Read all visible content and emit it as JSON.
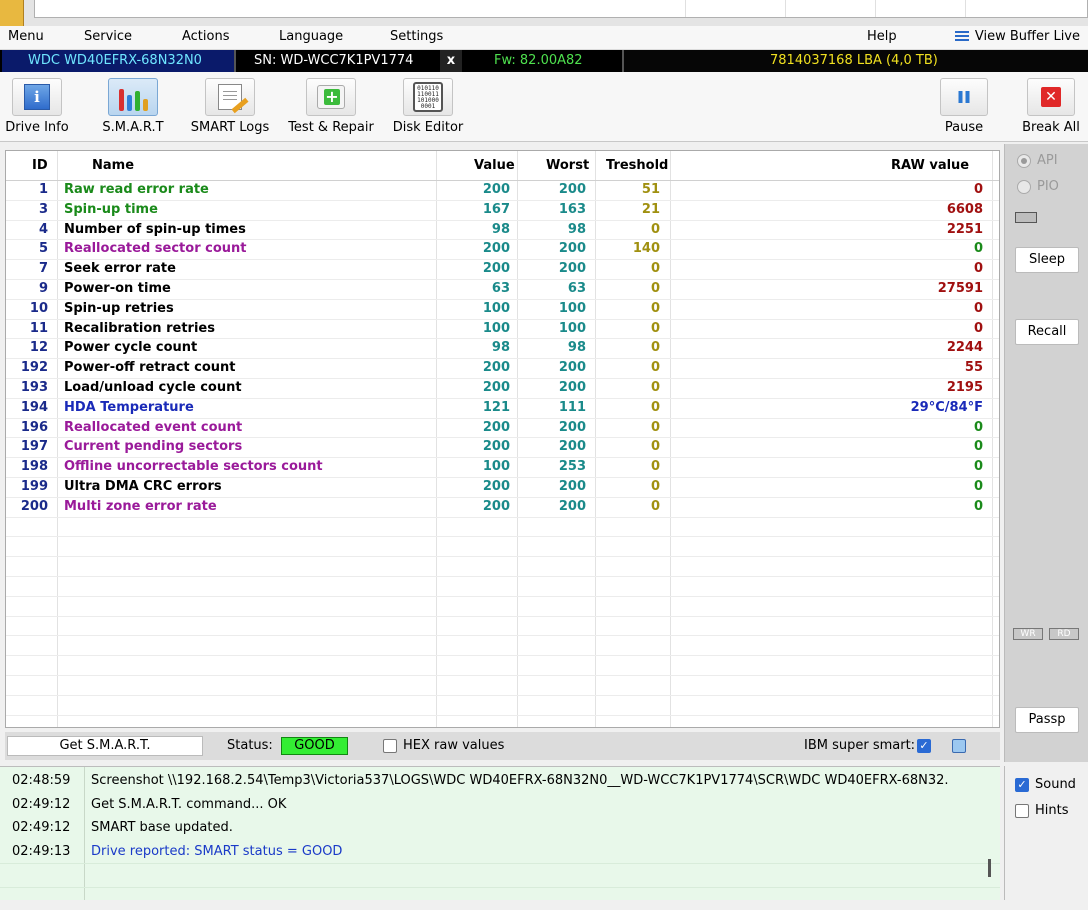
{
  "menu": {
    "items": [
      "Menu",
      "Service",
      "Actions",
      "Language",
      "Settings"
    ],
    "help": "Help",
    "view_buffer": "View Buffer Live"
  },
  "drive": {
    "model": "WDC WD40EFRX-68N32N0",
    "serial": "SN: WD-WCC7K1PV1774",
    "close": "x",
    "firmware": "Fw: 82.00A82",
    "capacity": "7814037168 LBA (4,0 TB)"
  },
  "toolbar": {
    "drive_info": "Drive Info",
    "smart": "S.M.A.R.T",
    "smart_logs": "SMART Logs",
    "test_repair": "Test & Repair",
    "disk_editor": "Disk Editor",
    "pause": "Pause",
    "break_all": "Break All",
    "disk_editor_glyph": "010110 110011 101000 0001"
  },
  "table": {
    "headers": {
      "id": "ID",
      "name": "Name",
      "value": "Value",
      "worst": "Worst",
      "threshold": "Treshold",
      "raw": "RAW value"
    },
    "rows": [
      {
        "id": "1",
        "name": "Raw read error rate",
        "value": "200",
        "worst": "200",
        "threshold": "51",
        "raw": "0",
        "name_color": "#1a8a1a",
        "raw_color": "#a01010"
      },
      {
        "id": "3",
        "name": "Spin-up time",
        "value": "167",
        "worst": "163",
        "threshold": "21",
        "raw": "6608",
        "name_color": "#1a8a1a",
        "raw_color": "#a01010"
      },
      {
        "id": "4",
        "name": "Number of spin-up times",
        "value": "98",
        "worst": "98",
        "threshold": "0",
        "raw": "2251",
        "name_color": "#000000",
        "raw_color": "#a01010"
      },
      {
        "id": "5",
        "name": "Reallocated sector count",
        "value": "200",
        "worst": "200",
        "threshold": "140",
        "raw": "0",
        "name_color": "#9a1a9a",
        "raw_color": "#1a8a1a"
      },
      {
        "id": "7",
        "name": "Seek error rate",
        "value": "200",
        "worst": "200",
        "threshold": "0",
        "raw": "0",
        "name_color": "#000000",
        "raw_color": "#a01010"
      },
      {
        "id": "9",
        "name": "Power-on time",
        "value": "63",
        "worst": "63",
        "threshold": "0",
        "raw": "27591",
        "name_color": "#000000",
        "raw_color": "#a01010"
      },
      {
        "id": "10",
        "name": "Spin-up retries",
        "value": "100",
        "worst": "100",
        "threshold": "0",
        "raw": "0",
        "name_color": "#000000",
        "raw_color": "#a01010"
      },
      {
        "id": "11",
        "name": "Recalibration retries",
        "value": "100",
        "worst": "100",
        "threshold": "0",
        "raw": "0",
        "name_color": "#000000",
        "raw_color": "#a01010"
      },
      {
        "id": "12",
        "name": "Power cycle count",
        "value": "98",
        "worst": "98",
        "threshold": "0",
        "raw": "2244",
        "name_color": "#000000",
        "raw_color": "#a01010"
      },
      {
        "id": "192",
        "name": "Power-off retract count",
        "value": "200",
        "worst": "200",
        "threshold": "0",
        "raw": "55",
        "name_color": "#000000",
        "raw_color": "#a01010"
      },
      {
        "id": "193",
        "name": "Load/unload cycle count",
        "value": "200",
        "worst": "200",
        "threshold": "0",
        "raw": "2195",
        "name_color": "#000000",
        "raw_color": "#a01010"
      },
      {
        "id": "194",
        "name": "HDA Temperature",
        "value": "121",
        "worst": "111",
        "threshold": "0",
        "raw": "29°C/84°F",
        "name_color": "#1a2ab8",
        "raw_color": "#1a2ab8"
      },
      {
        "id": "196",
        "name": "Reallocated event count",
        "value": "200",
        "worst": "200",
        "threshold": "0",
        "raw": "0",
        "name_color": "#9a1a9a",
        "raw_color": "#1a8a1a"
      },
      {
        "id": "197",
        "name": "Current pending sectors",
        "value": "200",
        "worst": "200",
        "threshold": "0",
        "raw": "0",
        "name_color": "#9a1a9a",
        "raw_color": "#1a8a1a"
      },
      {
        "id": "198",
        "name": "Offline uncorrectable sectors count",
        "value": "100",
        "worst": "253",
        "threshold": "0",
        "raw": "0",
        "name_color": "#9a1a9a",
        "raw_color": "#1a8a1a"
      },
      {
        "id": "199",
        "name": "Ultra DMA CRC errors",
        "value": "200",
        "worst": "200",
        "threshold": "0",
        "raw": "0",
        "name_color": "#000000",
        "raw_color": "#1a8a1a"
      },
      {
        "id": "200",
        "name": "Multi zone error rate",
        "value": "200",
        "worst": "200",
        "threshold": "0",
        "raw": "0",
        "name_color": "#9a1a9a",
        "raw_color": "#1a8a1a"
      }
    ]
  },
  "statusbar": {
    "get_smart": "Get S.M.A.R.T.",
    "status_label": "Status:",
    "status_value": "GOOD",
    "hex_label": "HEX raw values",
    "ibm_label": "IBM super smart:"
  },
  "side": {
    "api": "API",
    "pio": "PIO",
    "sleep": "Sleep",
    "recall": "Recall",
    "wr": "WR",
    "rd": "RD",
    "passp": "Passp",
    "sound": "Sound",
    "hints": "Hints"
  },
  "log": [
    {
      "time": "02:48:59",
      "msg": "Screenshot \\\\192.168.2.54\\Temp3\\Victoria537\\LOGS\\WDC WD40EFRX-68N32N0__WD-WCC7K1PV1774\\SCR\\WDC WD40EFRX-68N32.",
      "color": "#000000"
    },
    {
      "time": "02:49:12",
      "msg": "Get S.M.A.R.T. command... OK",
      "color": "#000000"
    },
    {
      "time": "02:49:12",
      "msg": "SMART base updated.",
      "color": "#000000"
    },
    {
      "time": "02:49:13",
      "msg": "Drive reported: SMART status = GOOD",
      "color": "#1a3ac8"
    }
  ]
}
